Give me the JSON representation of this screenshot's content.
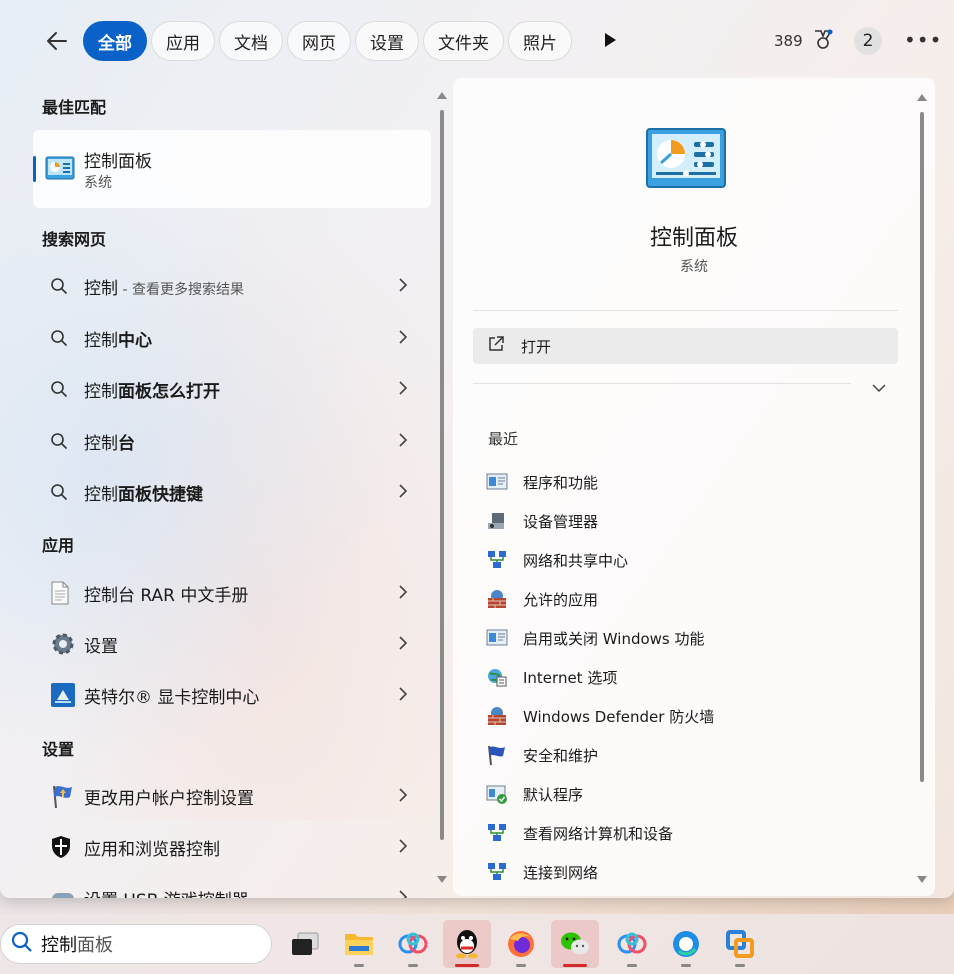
{
  "tabs": [
    {
      "label": "全部",
      "active": true
    },
    {
      "label": "应用"
    },
    {
      "label": "文档"
    },
    {
      "label": "网页"
    },
    {
      "label": "设置"
    },
    {
      "label": "文件夹"
    },
    {
      "label": "照片"
    }
  ],
  "topbar": {
    "points": "389",
    "notif_count": "2"
  },
  "left": {
    "best_match_header": "最佳匹配",
    "best_match": {
      "title": "控制面板",
      "subtitle": "系统"
    },
    "web_header": "搜索网页",
    "web_items": [
      {
        "prefix": "控制",
        "bold": "",
        "hint": " - 查看更多搜索结果"
      },
      {
        "prefix": "控制",
        "bold": "中心",
        "hint": ""
      },
      {
        "prefix": "控制",
        "bold": "面板怎么打开",
        "hint": ""
      },
      {
        "prefix": "控制",
        "bold": "台",
        "hint": ""
      },
      {
        "prefix": "控制",
        "bold": "面板快捷键",
        "hint": ""
      }
    ],
    "apps_header": "应用",
    "apps": [
      {
        "label": "控制台 RAR 中文手册",
        "icon": "document-icon"
      },
      {
        "label": "设置",
        "icon": "gear-icon"
      },
      {
        "label": "英特尔® 显卡控制中心",
        "icon": "intel-graphics-icon"
      }
    ],
    "settings_header": "设置",
    "settings": [
      {
        "label": "更改用户帐户控制设置",
        "icon": "uac-flag-icon"
      },
      {
        "label": "应用和浏览器控制",
        "icon": "shield-icon"
      },
      {
        "label": "设置 USB 游戏控制器",
        "icon": "game-controller-icon"
      }
    ]
  },
  "right": {
    "title": "控制面板",
    "subtitle": "系统",
    "open_label": "打开",
    "recent_header": "最近",
    "recent": [
      {
        "label": "程序和功能",
        "icon": "programs-icon"
      },
      {
        "label": "设备管理器",
        "icon": "device-manager-icon"
      },
      {
        "label": "网络和共享中心",
        "icon": "network-icon"
      },
      {
        "label": "允许的应用",
        "icon": "firewall-icon"
      },
      {
        "label": "启用或关闭 Windows 功能",
        "icon": "windows-features-icon"
      },
      {
        "label": "Internet 选项",
        "icon": "internet-options-icon"
      },
      {
        "label": "Windows Defender 防火墙",
        "icon": "firewall-icon"
      },
      {
        "label": "安全和维护",
        "icon": "security-flag-icon"
      },
      {
        "label": "默认程序",
        "icon": "default-programs-icon"
      },
      {
        "label": "查看网络计算机和设备",
        "icon": "network-icon"
      },
      {
        "label": "连接到网络",
        "icon": "network-icon"
      }
    ]
  },
  "taskbar": {
    "search_typed": "控制",
    "search_suggest": "面板",
    "apps": [
      "task-view-icon",
      "file-explorer-icon",
      "baidu-netdisk-icon",
      "qq-icon",
      "firefox-icon",
      "wechat-icon",
      "baidu-netdisk-icon",
      "edge-browser-icon",
      "app-icon"
    ]
  }
}
